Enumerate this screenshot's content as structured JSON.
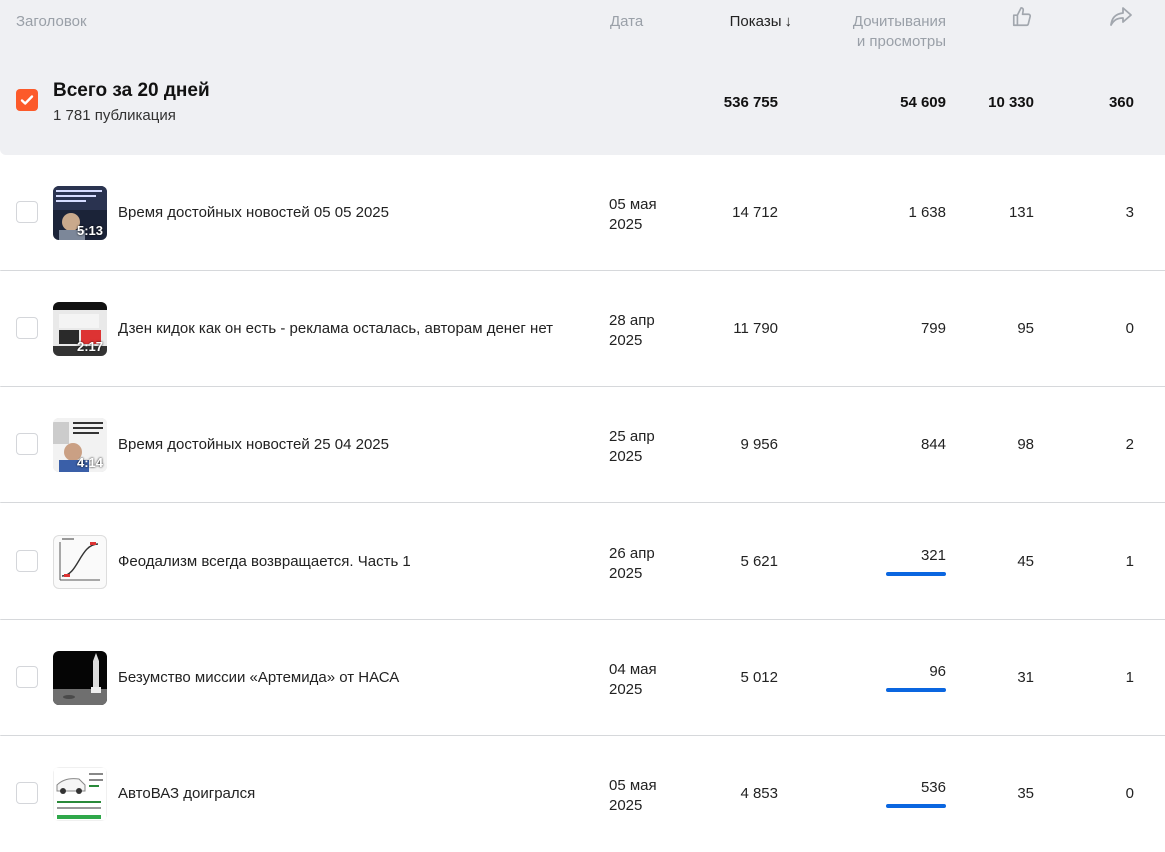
{
  "header": {
    "title_label": "Заголовок",
    "date_label": "Дата",
    "views_label": "Показы",
    "views_sort_arrow": "↓",
    "reads_label_line1": "Дочитывания",
    "reads_label_line2": "и просмотры",
    "likes_icon": "thumbs-up-icon",
    "shares_icon": "share-icon"
  },
  "total": {
    "title": "Всего за 20 дней",
    "subtitle": "1 781 публикация",
    "views": "536 755",
    "reads": "54 609",
    "likes": "10 330",
    "shares": "360",
    "checked": true
  },
  "rows": [
    {
      "title": "Время достойных новостей 05 05 2025",
      "date_line1": "05 мая",
      "date_line2": "2025",
      "duration": "5:13",
      "views": "14 712",
      "reads": "1 638",
      "likes": "131",
      "shares": "3"
    },
    {
      "title": "Дзен кидок как он есть - реклама осталась, авторам денег нет",
      "date_line1": "28 апр",
      "date_line2": "2025",
      "duration": "2:17",
      "views": "11 790",
      "reads": "799",
      "likes": "95",
      "shares": "0"
    },
    {
      "title": "Время достойных новостей 25 04 2025",
      "date_line1": "25 апр",
      "date_line2": "2025",
      "duration": "4:14",
      "views": "9 956",
      "reads": "844",
      "likes": "98",
      "shares": "2"
    },
    {
      "title": "Феодализм всегда возвращается. Часть 1",
      "date_line1": "26 апр",
      "date_line2": "2025",
      "duration": "",
      "views": "5 621",
      "reads": "321",
      "likes": "45",
      "shares": "1"
    },
    {
      "title": "Безумство миссии «Артемида» от НАСА",
      "date_line1": "04 мая",
      "date_line2": "2025",
      "duration": "",
      "views": "5 012",
      "reads": "96",
      "likes": "31",
      "shares": "1"
    },
    {
      "title": "АвтоВАЗ доигрался",
      "date_line1": "05 мая",
      "date_line2": "2025",
      "duration": "",
      "views": "4 853",
      "reads": "536",
      "likes": "35",
      "shares": "0"
    }
  ],
  "colors": {
    "accent": "#fc5a2a",
    "bar": "#0a66e0",
    "header_bg": "#eff0f3"
  }
}
